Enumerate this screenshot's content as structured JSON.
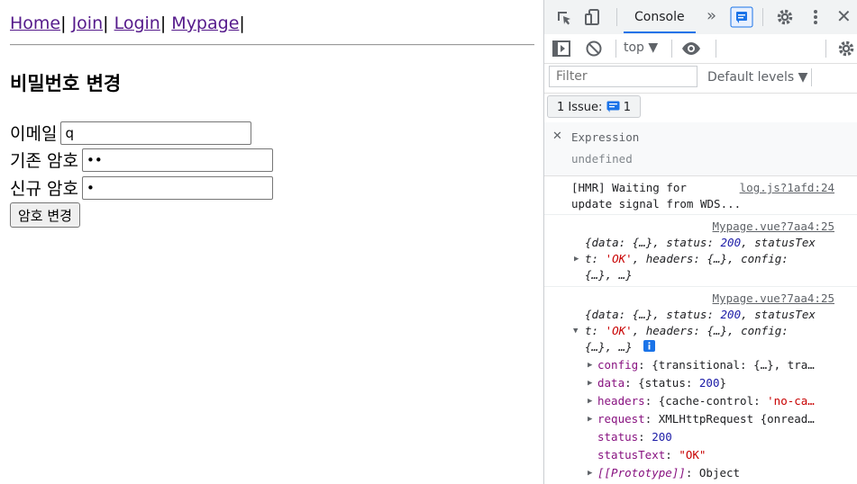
{
  "nav": {
    "links": [
      "Home",
      "Join",
      "Login",
      "Mypage"
    ],
    "separator": "|"
  },
  "form": {
    "title": "비밀번호 변경",
    "email_label": "이메일",
    "email_value": "q",
    "old_pw_label": "기존 암호",
    "old_pw_value": "••",
    "new_pw_label": "신규 암호",
    "new_pw_value": "•",
    "submit_label": "암호 변경"
  },
  "devtools": {
    "active_tab": "Console",
    "context": "top",
    "filter_placeholder": "Filter",
    "levels_label": "Default levels",
    "issues_label": "1 Issue:",
    "issues_count": "1",
    "expression": {
      "title": "Expression",
      "value": "undefined"
    },
    "messages": [
      {
        "source": "log.js?1afd:24",
        "text1": "[HMR] Waiting for",
        "text2": "update signal from WDS..."
      },
      {
        "source": "Mypage.vue?7aa4:25"
      },
      {
        "source": "Mypage.vue?7aa4:25"
      }
    ],
    "object_summary": {
      "l1_a": "{data: {…}, status: ",
      "status_val": "200",
      "l1_b": ", statusTex",
      "l2_a": "t: ",
      "ok_val": "'OK'",
      "l2_b": ", headers: {…}, config:",
      "l3": "{…}, …}"
    },
    "expanded": {
      "config_key": "config",
      "config_val": ": {transitional: {…}, tra…",
      "data_key": "data",
      "data_val_a": ": {status: ",
      "data_val_num": "200",
      "data_val_b": "}",
      "headers_key": "headers",
      "headers_val_a": ": {cache-control: ",
      "headers_val_str": "'no-ca…",
      "request_key": "request",
      "request_val": ": XMLHttpRequest {onread…",
      "status_key": "status",
      "status_val": "200",
      "statustext_key": "statusText",
      "statustext_val": "\"OK\"",
      "proto_key": "[[Prototype]]",
      "proto_val": ": Object"
    }
  },
  "colors": {
    "link": "#551a8b",
    "accent": "#1a73e8",
    "number": "#1a1aa6",
    "string": "#c80000",
    "key": "#881280"
  }
}
